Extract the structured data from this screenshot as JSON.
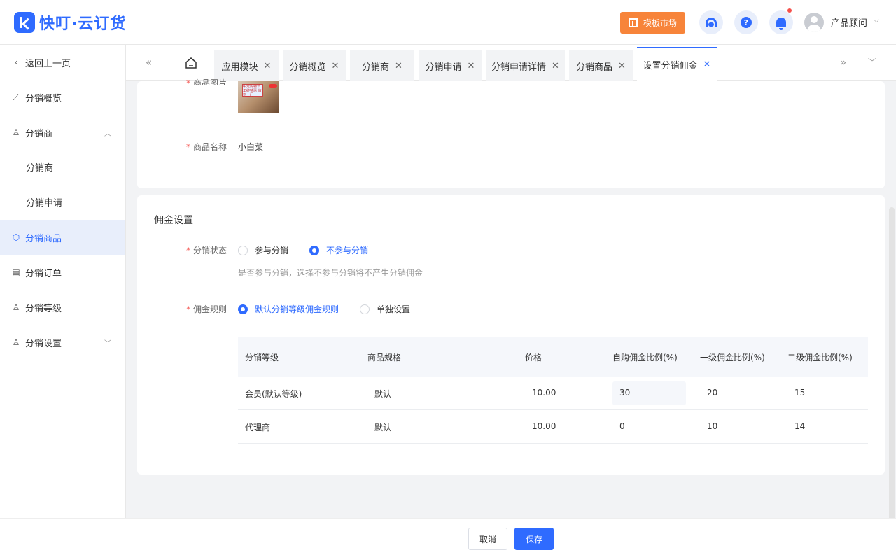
{
  "header": {
    "logo_text": "快叮·云订货",
    "template_market_label": "模板市场",
    "help_label": "?",
    "user_name": "产品顾问",
    "user_caret": "⌵"
  },
  "sidebar": {
    "back_label": "返回上一页",
    "items": [
      {
        "label": "分销概览"
      },
      {
        "label": "分销商"
      },
      {
        "label": "分销商"
      },
      {
        "label": "分销申请"
      },
      {
        "label": "分销商品"
      },
      {
        "label": "分销订单"
      },
      {
        "label": "分销等级"
      },
      {
        "label": "分销设置"
      }
    ]
  },
  "tabs": [
    {
      "label": "应用模块"
    },
    {
      "label": "分销概览"
    },
    {
      "label": "分销商"
    },
    {
      "label": "分销申请"
    },
    {
      "label": "分销申请详情"
    },
    {
      "label": "分销商品"
    },
    {
      "label": "设置分销佣金"
    }
  ],
  "product": {
    "image_label": "商品图片",
    "name_label": "商品名称",
    "name_value": "小白菜",
    "image_text": "中元购物节 年终特惠 值到上门"
  },
  "commission": {
    "section_title": "佣金设置",
    "status_label": "分销状态",
    "status_options": [
      "参与分销",
      "不参与分销"
    ],
    "status_selected": "不参与分销",
    "status_hint": "是否参与分销，选择不参与分销将不产生分销佣金",
    "rule_label": "佣金规则",
    "rule_options": [
      "默认分销等级佣金规则",
      "单独设置"
    ],
    "rule_selected": "默认分销等级佣金规则",
    "table": {
      "headers": [
        "分销等级",
        "商品规格",
        "价格",
        "自购佣金比例(%)",
        "一级佣金比例(%)",
        "二级佣金比例(%)"
      ],
      "rows": [
        {
          "level": "会员(默认等级)",
          "spec": "默认",
          "price": "10.00",
          "self": "30",
          "first": "20",
          "second": "15"
        },
        {
          "level": "代理商",
          "spec": "默认",
          "price": "10.00",
          "self": "0",
          "first": "10",
          "second": "14"
        }
      ]
    }
  },
  "footer": {
    "cancel_label": "取消",
    "save_label": "保存"
  },
  "colors": {
    "primary": "#2f6bff",
    "template_button": "#f7843a",
    "required_mark": "#f5504b"
  }
}
